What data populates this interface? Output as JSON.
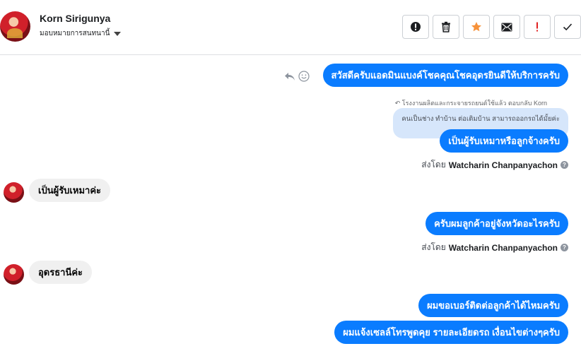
{
  "header": {
    "contact_name": "Korn Sirigunya",
    "assign_label": "มอบหมายการสนทนานี้",
    "actions": [
      "alert-icon",
      "trash-icon",
      "star-icon",
      "mail-icon",
      "exclamation-icon",
      "check-icon"
    ],
    "colors": {
      "star": "#f7923a",
      "exclamation": "#e02020"
    }
  },
  "messages": {
    "m1": "สวัสดีครับแอดมินแบงค์โชคคุณโชคอุดรยินดีให้บริการครับ",
    "reply_note": "โรงงานผลิตและกระจายรถยนต์ใช้แล้ว ตอบกลับ Korn",
    "quoted": "คนเป็นช่าง ทำบ้าน ต่อเติมบ้าน สามารถออกรถได้มั้ยค่ะ",
    "m2": "เป็นผู้รับเหมาหรือลูกจ้างครับ",
    "sent_by_prefix": "ส่งโดย",
    "sent_by_name": "Watcharin Chanpanyachon",
    "in1": "เป็นผู้รับเหมาค่ะ",
    "m3": "ครับผมลูกค้าอยู่จังหวัดอะไรครับ",
    "in2": "อุดรธานีค่ะ",
    "m4": "ผมขอเบอร์ติดต่อลูกค้าได้ไหมครับ",
    "m5": "ผมแจ้งเซลล์โทรพูดคุย รายละเอียดรถ เงื่อนไขต่างๆครับ"
  },
  "colors": {
    "outgoing": "#0a7cff",
    "incoming": "#f0f0f0",
    "quote": "#d6e6fb"
  }
}
